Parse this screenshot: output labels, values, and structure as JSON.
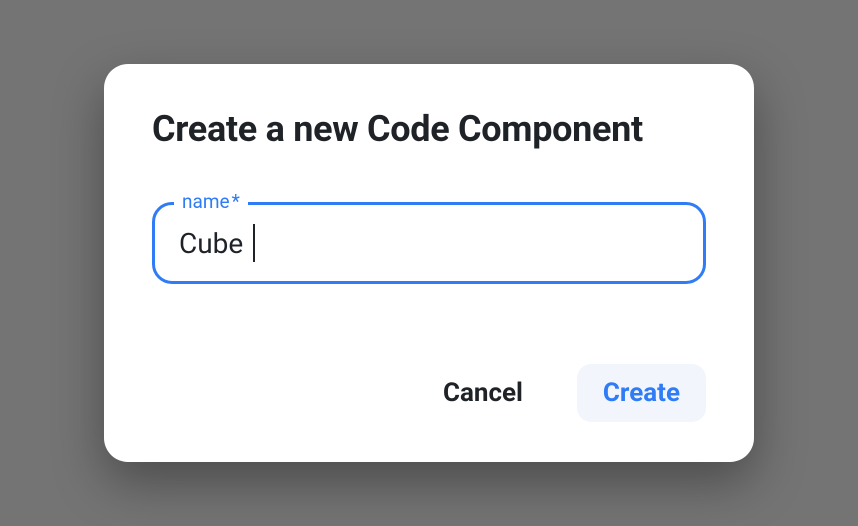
{
  "modal": {
    "title": "Create a new Code Component",
    "field": {
      "label": "name",
      "required_marker": "*",
      "value": "Cube"
    },
    "buttons": {
      "cancel": "Cancel",
      "create": "Create"
    }
  }
}
